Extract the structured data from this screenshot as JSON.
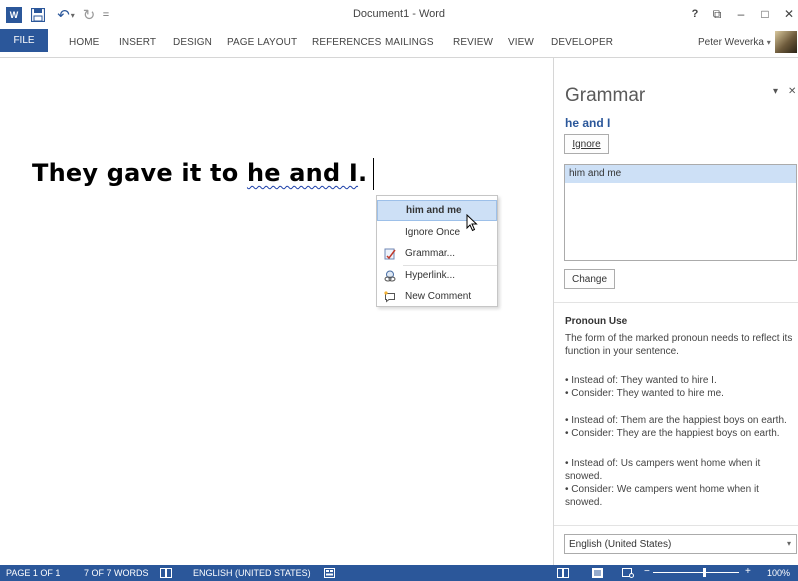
{
  "window": {
    "title": "Document1 - Word",
    "logo_text": "W",
    "help_glyph": "?",
    "ribbon_display_glyph": "⧉",
    "minimize_glyph": "–",
    "maximize_glyph": "□",
    "close_glyph": "✕"
  },
  "qat": {
    "undo_glyph": "↶",
    "undo_more": "▾",
    "redo_glyph": "↻",
    "more_glyph": "="
  },
  "ribbon": {
    "tabs": [
      "FILE",
      "HOME",
      "INSERT",
      "DESIGN",
      "PAGE LAYOUT",
      "REFERENCES",
      "MAILINGS",
      "REVIEW",
      "VIEW",
      "DEVELOPER"
    ],
    "active_tab": "FILE",
    "user_name": "Peter Weverka",
    "user_menu_glyph": "▾"
  },
  "document": {
    "text_before": "They gave it to ",
    "text_flagged": "he and I",
    "text_after": "."
  },
  "context_menu": {
    "suggestion": "him and me",
    "items": [
      {
        "label": "Ignore Once",
        "icon": "none"
      },
      {
        "label": "Grammar...",
        "icon": "grammar-icon"
      },
      {
        "label": "Hyperlink...",
        "icon": "hyperlink-icon"
      },
      {
        "label": "New Comment",
        "icon": "new-comment-icon"
      }
    ]
  },
  "grammar_pane": {
    "title": "Grammar",
    "menu_glyph": "▾",
    "close_glyph": "✕",
    "flagged_text": "he and I",
    "ignore_label": "Ignore",
    "suggestions": [
      "him and me"
    ],
    "change_label": "Change",
    "rule_title": "Pronoun Use",
    "rule_description": "The form of the marked pronoun needs to reflect its function in your sentence.",
    "examples": [
      {
        "instead": "• Instead of: They wanted to hire I.",
        "consider": "• Consider: They wanted to hire me."
      },
      {
        "instead": "• Instead of: Them are the happiest boys on earth.",
        "consider": "• Consider: They are the happiest boys on earth."
      },
      {
        "instead": "• Instead of: Us campers went home when it snowed.",
        "consider": "• Consider: We campers went home when it snowed."
      }
    ],
    "language": "English (United States)",
    "language_arrow": "▾"
  },
  "status_bar": {
    "page": "PAGE 1 OF 1",
    "words": "7 OF 7 WORDS",
    "language": "ENGLISH (UNITED STATES)",
    "zoom_minus": "−",
    "zoom_plus": "+",
    "zoom": "100%",
    "zoom_level_percent": 100
  },
  "colors": {
    "accent": "#2b579a",
    "suggestion_highlight": "#cde0f6"
  }
}
